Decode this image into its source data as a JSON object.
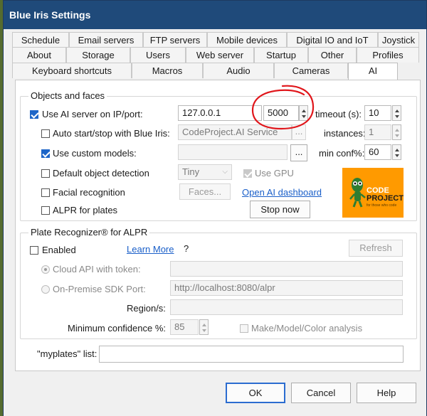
{
  "window": {
    "title": "Blue Iris Settings"
  },
  "tabs": {
    "row1": [
      "Schedule",
      "Email servers",
      "FTP servers",
      "Mobile devices",
      "Digital IO and IoT",
      "Joystick"
    ],
    "row2": [
      "About",
      "Storage",
      "Users",
      "Web server",
      "Startup",
      "Other",
      "Profiles"
    ],
    "row3": [
      "Keyboard shortcuts",
      "Macros",
      "Audio",
      "Cameras",
      "AI"
    ],
    "active": "AI"
  },
  "objects": {
    "group_title": "Objects and faces",
    "use_ai_label": "Use AI server on IP/port:",
    "use_ai_checked": true,
    "ip_value": "127.0.0.1",
    "port_value": "5000",
    "timeout_label": "timeout (s):",
    "timeout_value": "10",
    "auto_start_label": "Auto start/stop with Blue Iris:",
    "auto_start_checked": false,
    "service_value": "CodeProject.AI Service",
    "browse_label": "...",
    "instances_label": "instances:",
    "instances_value": "1",
    "custom_models_label": "Use custom models:",
    "custom_models_checked": true,
    "custom_models_value": "",
    "custom_browse_label": "...",
    "min_conf_label": "min conf%:",
    "min_conf_value": "60",
    "default_detection_label": "Default object detection",
    "default_detection_checked": false,
    "model_size_value": "Tiny",
    "use_gpu_label": "Use GPU",
    "use_gpu_checked": true,
    "facial_label": "Facial recognition",
    "facial_checked": false,
    "faces_button": "Faces...",
    "dashboard_link": "Open AI dashboard",
    "alpr_label": "ALPR for plates",
    "alpr_checked": false,
    "stop_button": "Stop now",
    "logo_top": "CODE",
    "logo_bottom": "PROJECT",
    "logo_tagline": "for those who code"
  },
  "plate": {
    "group_title": "Plate Recognizer® for ALPR",
    "enabled_label": "Enabled",
    "enabled_checked": false,
    "learn_more": "Learn More",
    "help_mark": "?",
    "refresh_button": "Refresh",
    "cloud_label": "Cloud API with token:",
    "cloud_value": "",
    "onprem_label": "On-Premise SDK Port:",
    "onprem_value": "http://localhost:8080/alpr",
    "region_label": "Region/s:",
    "region_value": "",
    "min_conf_label": "Minimum confidence %:",
    "min_conf_value": "85",
    "mmc_label": "Make/Model/Color analysis",
    "mmc_checked": false
  },
  "myplates": {
    "label": "\"myplates\" list:",
    "value": ""
  },
  "footer": {
    "ok": "OK",
    "cancel": "Cancel",
    "help": "Help"
  },
  "colors": {
    "titlebar": "#1f4a7a",
    "annotation": "#e0161b",
    "logo_bg": "#ff9a00",
    "checkbox": "#1e66c8"
  }
}
